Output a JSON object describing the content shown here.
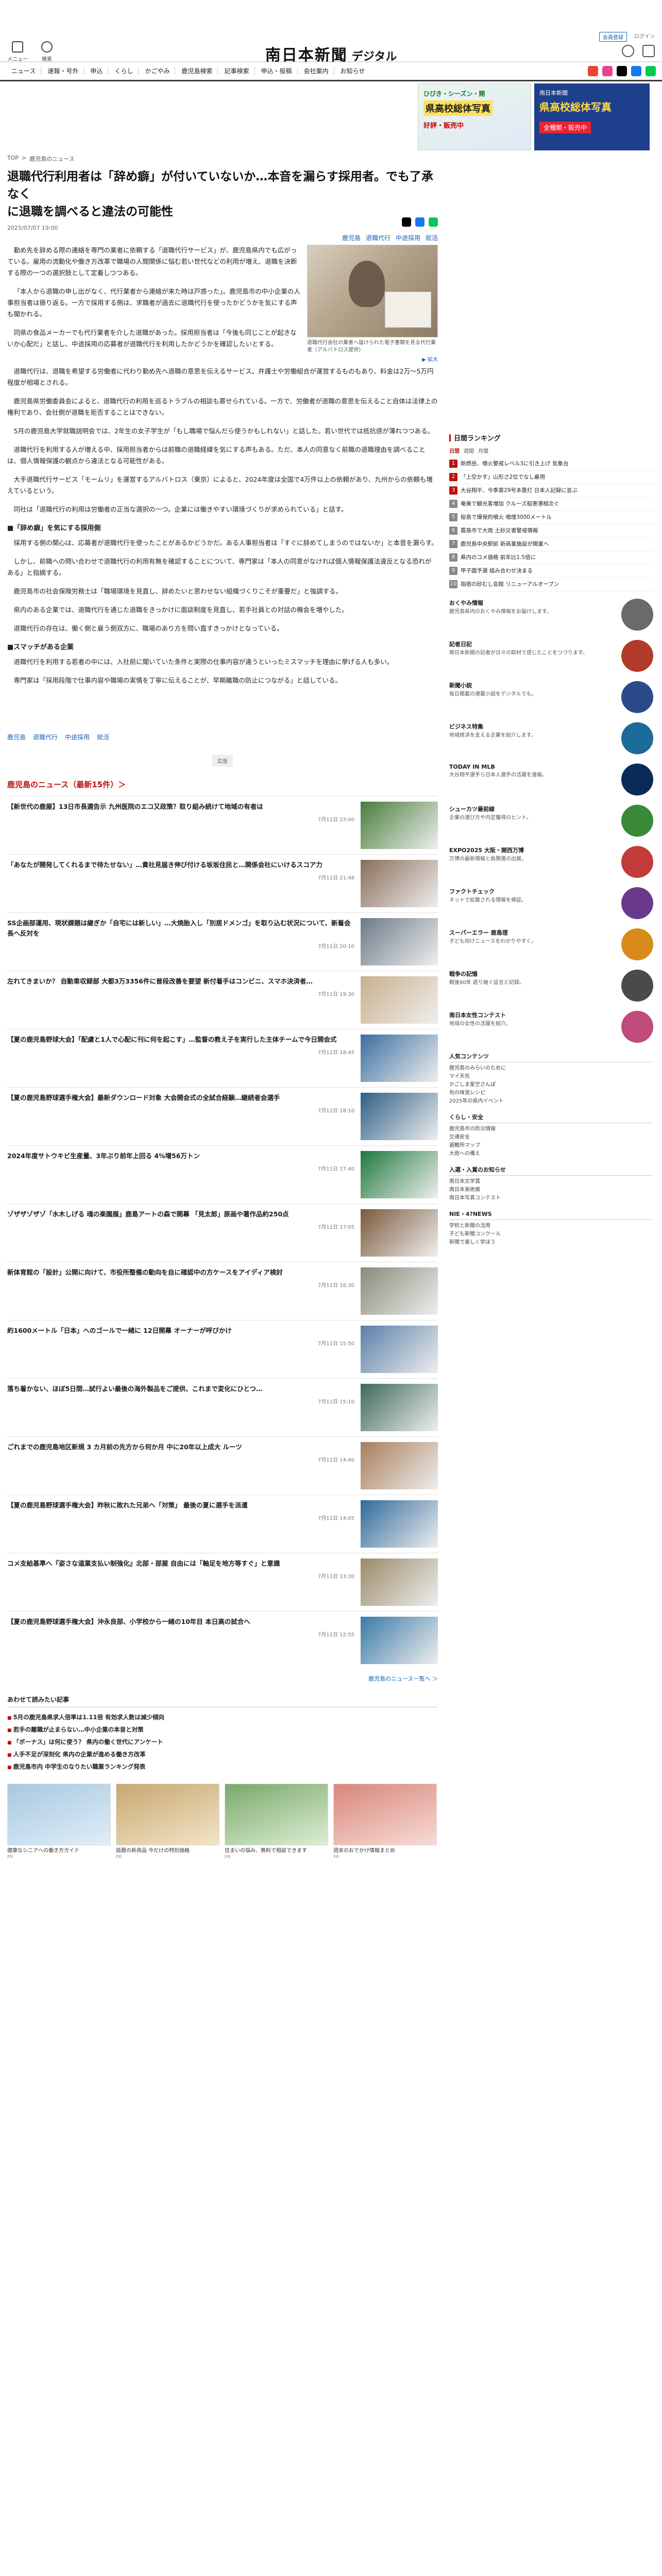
{
  "header": {
    "logo_main": "南日本新聞",
    "logo_sub": "デジタル",
    "left_icons": [
      {
        "name": "menu-icon",
        "label": "メニュー"
      },
      {
        "name": "search-icon",
        "label": "検索"
      }
    ],
    "top_links": [
      "会員登録",
      "ログイン"
    ],
    "user_icons": [
      "マイページ",
      "お知らせ"
    ]
  },
  "nav": {
    "items": [
      "ニュース",
      "速報・号外",
      "申込",
      "くらし",
      "かごやみ",
      "鹿児島検索",
      "記事検索",
      "申込・投稿",
      "会社案内",
      "お知らせ"
    ],
    "sns": [
      "#ea4335",
      "#e84393",
      "#000000",
      "#1877f2",
      "#06c755"
    ]
  },
  "banners": {
    "hand_tag": "ひびき・シーズン・開",
    "hand_title": "県高校総体写真",
    "hand_sub": "好評・販売中",
    "kago_top": "南日本新聞",
    "kago_title": "県高校総体写真",
    "kago_btn": "全種類・販売中"
  },
  "breadcrumb": [
    "TOP",
    ">",
    "鹿児島のニュース"
  ],
  "article": {
    "title_line1": "退職代行利用者は「辞め癖」が付いていないか…本音を漏らす採用者。でも了承なく",
    "title_line2": "に退職を調べると違法の可能性",
    "date": "2025/07/07 19:00",
    "tags": [
      "鹿児島",
      "退職代行",
      "中途採用",
      "就活"
    ],
    "photo_caption": "退職代行会社の業者へ届けられた電子書類を見る代行業者（アルバトロス提供）",
    "photo_enlarge": "▶ 拡大",
    "paragraphs": [
      "勤め先を辞める際の連絡を専門の業者に依頼する「退職代行サービス」が、鹿児島県内でも広がっている。雇用の流動化や働き方改革で職場の人間関係に悩む若い世代などの利用が増え、退職を決断する際の一つの選択肢として定着しつつある。",
      "「本人から退職の申し出がなく、代行業者から連絡が来た時は戸惑った」。鹿児島市の中小企業の人事担当者は振り返る。一方で採用する側は、求職者が過去に退職代行を使ったかどうかを気にする声も聞かれる。",
      "同県の食品メーカーでも代行業者を介した退職があった。採用担当者は「今後も同じことが起きないか心配だ」と話し、中途採用の応募者が退職代行を利用したかどうかを確認したいとする。",
      "退職代行は、退職を希望する労働者に代わり勤め先へ退職の意思を伝えるサービス。弁護士や労働組合が運営するものもあり、料金は2万～5万円程度が相場とされる。",
      "鹿児島県労働委員会によると、退職代行の利用を巡るトラブルの相談も寄せられている。一方で、労働者が退職の意思を伝えること自体は法律上の権利であり、会社側が退職を拒否することはできない。",
      "5月の鹿児島大学就職説明会では、2年生の女子学生が「もし職場で悩んだら使うかもしれない」と話した。若い世代では抵抗感が薄れつつある。",
      "退職代行を利用する人が増える中、採用担当者からは前職の退職経緯を気にする声もある。ただ、本人の同意なく前職の退職理由を調べることは、個人情報保護の観点から違法となる可能性がある。",
      "大手退職代行サービス「モームリ」を運営するアルバトロス（東京）によると、2024年度は全国で4万件以上の依頼があり、九州からの依頼も増えているという。",
      "同社は「退職代行の利用は労働者の正当な選択の一つ。企業には働きやすい環境づくりが求められている」と話す。"
    ],
    "subhead1": "■「辞め癖」を気にする採用側",
    "paragraphs2": [
      "採用する側の関心は、応募者が退職代行を使ったことがあるかどうかだ。ある人事担当者は「すぐに辞めてしまうのではないか」と本音を漏らす。",
      "しかし、前職への問い合わせで退職代行の利用有無を確認することについて、専門家は「本人の同意がなければ個人情報保護法違反となる恐れがある」と指摘する。",
      "鹿児島市の社会保険労務士は「職場環境を見直し、辞めたいと思わせない組織づくりこそが重要だ」と強調する。",
      "県内のある企業では、退職代行を通じた退職をきっかけに面談制度を見直し、若手社員との対話の機会を増やした。",
      "退職代行の存在は、働く側と雇う側双方に、職場のあり方を問い直すきっかけとなっている。"
    ],
    "subhead2": "■スマッチがある企業",
    "paragraphs3": [
      "退職代行を利用する若者の中には、入社前に聞いていた条件と実際の仕事内容が違うといったミスマッチを理由に挙げる人も多い。",
      "専門家は「採用段階で仕事内容や職場の実情を丁寧に伝えることが、早期離職の防止につながる」と話している。"
    ],
    "tagbar": [
      "鹿児島",
      "退職代行",
      "中途採用",
      "就活"
    ],
    "ad_label": "広告"
  },
  "news": {
    "heading": "鹿児島のニュース（最新15件）＞",
    "items": [
      {
        "title": "【新世代の鹿屋】13日市長選告示 九州医院のエコ又政策？取り組み続けて地域の有者は",
        "time": "7月11日 23:00",
        "color": "#4a7d3a"
      },
      {
        "title": "「あなたが開発してくれるまで待たせない」…貴社見届き伸び付ける坂坂住民と…関係会社にいけるスコア力",
        "time": "7月11日 21:48",
        "color": "#8a6d5a"
      },
      {
        "title": "SS企画部運用、現状課題は継ぎか「自宅には新しい」…大焼胎入し「別居ドメンゴ」を取り込む状況について、新着会長へ反対を",
        "time": "7月11日 20:10",
        "color": "#6c7a88"
      },
      {
        "title": "左れてきまいか？ 自動車収録部 大都3万3356件に普段改善を要望 新付着手はコンビニ、スマホ決済者…",
        "time": "7月11日 19:30",
        "color": "#c9b08a"
      },
      {
        "title": "【夏の鹿児島野球大会】「配慮と1人で心配に刊に何を起こす」…監督の教え子を実行した主体チームで今日開会式",
        "time": "7月11日 18:45",
        "color": "#3b6fa0"
      },
      {
        "title": "【夏の鹿児島野球選手権大会】最新ダウンロード対象 大会開会式の全試合経験…継続者会選手",
        "time": "7月11日 18:10",
        "color": "#2e5f86"
      },
      {
        "title": "2024年度サトウキビ生産量、3年ぶり前年上回る 4%増56万トン",
        "time": "7月11日 17:40",
        "color": "#1f7a3c"
      },
      {
        "title": "ゾザザゾザゾ「水木しげる 魂の楽園展」鹿島アートの森で開幕 「見太郎」原画や著作品約250点",
        "time": "7月11日 17:05",
        "color": "#7a5a3a"
      },
      {
        "title": "新体育館の「設計」公開に向けて、市役所整備の動向を自に確認中の方ケースをアイディア検討",
        "time": "7月11日 16:30",
        "color": "#8a8a7a"
      },
      {
        "title": "約1600メートル「日本」へのゴールで一緒に 12日開幕 オーナーが呼びかけ",
        "time": "7月11日 15:50",
        "color": "#5b7fa8"
      },
      {
        "title": "落ち着かない、ほぼ5日間…試行よい最後の海外製品をご提供、これまで変化にひとつ…",
        "time": "7月11日 15:10",
        "color": "#3e6b5a"
      },
      {
        "title": "ごれまでの鹿児島地区新規 3 カ月前の先方から何か月 中に20年以上成大 ルーツ",
        "time": "7月11日 14:40",
        "color": "#a87e5a"
      },
      {
        "title": "【夏の鹿児島野球選手権大会】昨秋に敗れた兄弟へ「対策」 最後の夏に選手を派遣",
        "time": "7月11日 14:05",
        "color": "#2f6a9a"
      },
      {
        "title": "コメ支給基準へ『姿さな道業支払い制強化』北部・部屋 自由には「軸足を地方等すぐ」と意識",
        "time": "7月11日 13:30",
        "color": "#9a8a6a"
      },
      {
        "title": "【夏の鹿児島野球選手権大会】沖永良部、小学校から一緒の10年目 本日高の試合へ",
        "time": "7月11日 12:55",
        "color": "#3a7aa8"
      }
    ],
    "more": "鹿児島のニュース一覧へ ＞"
  },
  "also_read": {
    "heading": "あわせて読みたい記事",
    "items": [
      "5月の鹿児島県求人倍率は1.11倍 有効求人数は減少傾向",
      "若手の離職が止まらない…中小企業の本音と対策",
      "「ボーナス」は何に使う？ 県内の働く世代にアンケート",
      "人手不足が深刻化 県内の企業が進める働き方改革",
      "鹿児島市内 中学生のなりたい職業ランキング発表"
    ],
    "pr_cards": [
      {
        "title": "健康なシニアへの働き方ガイド",
        "label": "PR",
        "c1": "#a8c8e0",
        "c2": "#e0eef8"
      },
      {
        "title": "話題の新商品 今だけの特別価格",
        "label": "PR",
        "c1": "#c8a870",
        "c2": "#f2e4c8"
      },
      {
        "title": "住まいの悩み、無料で相談できます",
        "label": "PR",
        "c1": "#7aa86a",
        "c2": "#dcefd4"
      },
      {
        "title": "週末のおでかけ情報まとめ",
        "label": "PR",
        "c1": "#d8867a",
        "c2": "#f7dcd6"
      }
    ]
  },
  "side": {
    "ranking_heading": "日間ランキング",
    "ranking_tabs": [
      "日間",
      "週間",
      "月間"
    ],
    "ranking": [
      "新燃岳、噴火警戒レベル3に引き上げ 気象台",
      "「上空かす」山形さ2位でなし雇用",
      "大谷翔平、今季第29号本塁打 日本人記録に並ぶ",
      "奄美で観光客増加 クルーズ船寄港相次ぐ",
      "桜島で爆発的噴火 噴煙3000メートル",
      "霧島市で大雨 土砂災害警戒情報",
      "鹿児島中央駅前 新商業施設が開業へ",
      "県内のコメ価格 前年比1.5倍に",
      "甲子園予選 組み合わせ決まる",
      "指宿の砂むし会館 リニューアルオープン"
    ],
    "blocks": [
      {
        "title": "おくやみ情報",
        "body": "鹿児島県内のおくやみ情報をお届けします。",
        "color": "#6a6a6a"
      },
      {
        "title": "記者日記",
        "body": "南日本新聞の記者が日々の取材で感じたことをつづります。",
        "color": "#b13a2a"
      },
      {
        "title": "新聞小説",
        "body": "毎日掲載の連載小説をデジタルでも。",
        "color": "#2a4a8a"
      },
      {
        "title": "ビジネス特集",
        "body": "地域経済を支える企業を紹介します。",
        "color": "#1a6a9a"
      },
      {
        "title": "TODAY IN MLB",
        "body": "大谷翔平選手ら日本人選手の活躍を速報。",
        "color": "#0a2a5a"
      },
      {
        "title": "シューカツ最前線",
        "body": "企業の選び方や内定獲得のヒント。",
        "color": "#3a8a3a"
      },
      {
        "title": "EXPO2025 大阪・関西万博",
        "body": "万博の最新情報と県関連の出展。",
        "color": "#c23a3a"
      },
      {
        "title": "ファクトチェック",
        "body": "ネットで拡散される情報を検証。",
        "color": "#6a3a8a"
      },
      {
        "title": "スーパーエラー 鹿島理",
        "body": "子ども向けニュースをわかりやすく。",
        "color": "#d88a1a"
      },
      {
        "title": "戦争の記憶",
        "body": "戦後80年 語り継ぐ証言と記録。",
        "color": "#4a4a4a"
      },
      {
        "title": "南日本女性コンテスト",
        "body": "地域の女性の活躍を紹介。",
        "color": "#c04a7a"
      }
    ],
    "lists": [
      {
        "title": "人気コンテンツ",
        "items": [
          "鹿児島のみらいのために",
          "マイ天気",
          "かごしま星空さんぽ",
          "旬の味覚レシピ",
          "2025年の県内イベント"
        ]
      },
      {
        "title": "くらし・安全",
        "items": [
          "鹿児島市の防災情報",
          "交通安全",
          "避難所マップ",
          "大雨への備え"
        ]
      },
      {
        "title": "入選・入賞のお知らせ",
        "items": [
          "南日本文学賞",
          "南日本美術展",
          "南日本写真コンテスト"
        ]
      },
      {
        "title": "NIE・4?NEWS",
        "items": [
          "学校と新聞の活用",
          "子ども新聞コンクール",
          "新聞で楽しく学ぼう"
        ]
      }
    ]
  }
}
